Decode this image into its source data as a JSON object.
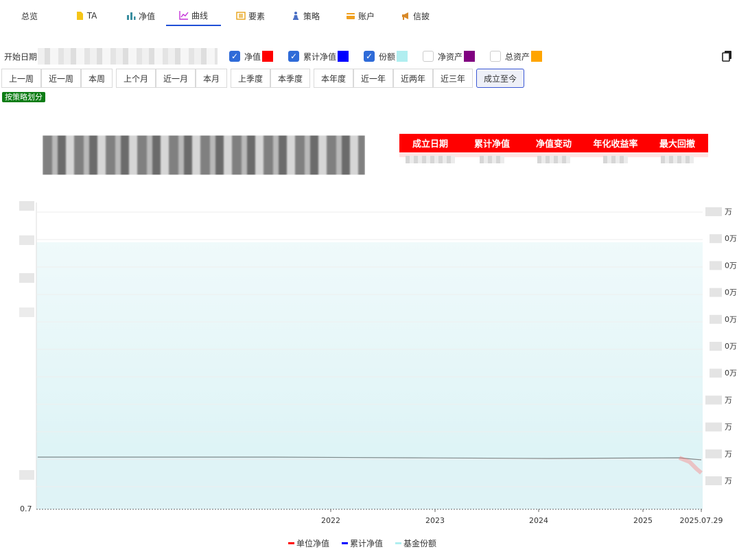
{
  "nav": {
    "tabs": [
      {
        "label": "总览",
        "icon": "overview",
        "active": false
      },
      {
        "label": "TA",
        "icon": "ta-tag-icon",
        "active": false
      },
      {
        "label": "净值",
        "icon": "bar-chart-icon",
        "active": false
      },
      {
        "label": "曲线",
        "icon": "line-chart-icon",
        "active": true
      },
      {
        "label": "要素",
        "icon": "list-icon",
        "active": false
      },
      {
        "label": "策略",
        "icon": "chess-icon",
        "active": false
      },
      {
        "label": "账户",
        "icon": "card-icon",
        "active": false
      },
      {
        "label": "信披",
        "icon": "megaphone-icon",
        "active": false
      }
    ]
  },
  "filters": {
    "start_date_label": "开始日期",
    "series_toggles": [
      {
        "label": "净值",
        "checked": true,
        "color": "#ff0000"
      },
      {
        "label": "累计净值",
        "checked": true,
        "color": "#0000ff"
      },
      {
        "label": "份额",
        "checked": true,
        "color": "#b0eef0"
      },
      {
        "label": "净资产",
        "checked": false,
        "color": "#800080"
      },
      {
        "label": "总资产",
        "checked": false,
        "color": "#ffa500"
      }
    ]
  },
  "periods": [
    "上一周",
    "近一周",
    "本周",
    "上个月",
    "近一月",
    "本月",
    "上季度",
    "本季度",
    "本年度",
    "近一年",
    "近两年",
    "近三年",
    "成立至今"
  ],
  "active_period": "成立至今",
  "strategy_badge": "按策略划分",
  "stats_table": {
    "headers": [
      "成立日期",
      "累计净值",
      "净值变动",
      "年化收益率",
      "最大回撤"
    ]
  },
  "chart_data": {
    "type": "line",
    "x_ticks": [
      "2022",
      "2023",
      "2024",
      "2025",
      "2025.07.29"
    ],
    "left_axis_min_label": "0.7",
    "right_axis_tick_suffix": [
      "万",
      "0万",
      "0万",
      "0万",
      "0万",
      "0万",
      "0万",
      "万",
      "万",
      "万",
      "万"
    ],
    "series": [
      {
        "name": "单位净值",
        "color": "#ff0000"
      },
      {
        "name": "累计净值",
        "color": "#0000ff"
      },
      {
        "name": "基金份额",
        "color": "#b0eef0"
      }
    ]
  }
}
